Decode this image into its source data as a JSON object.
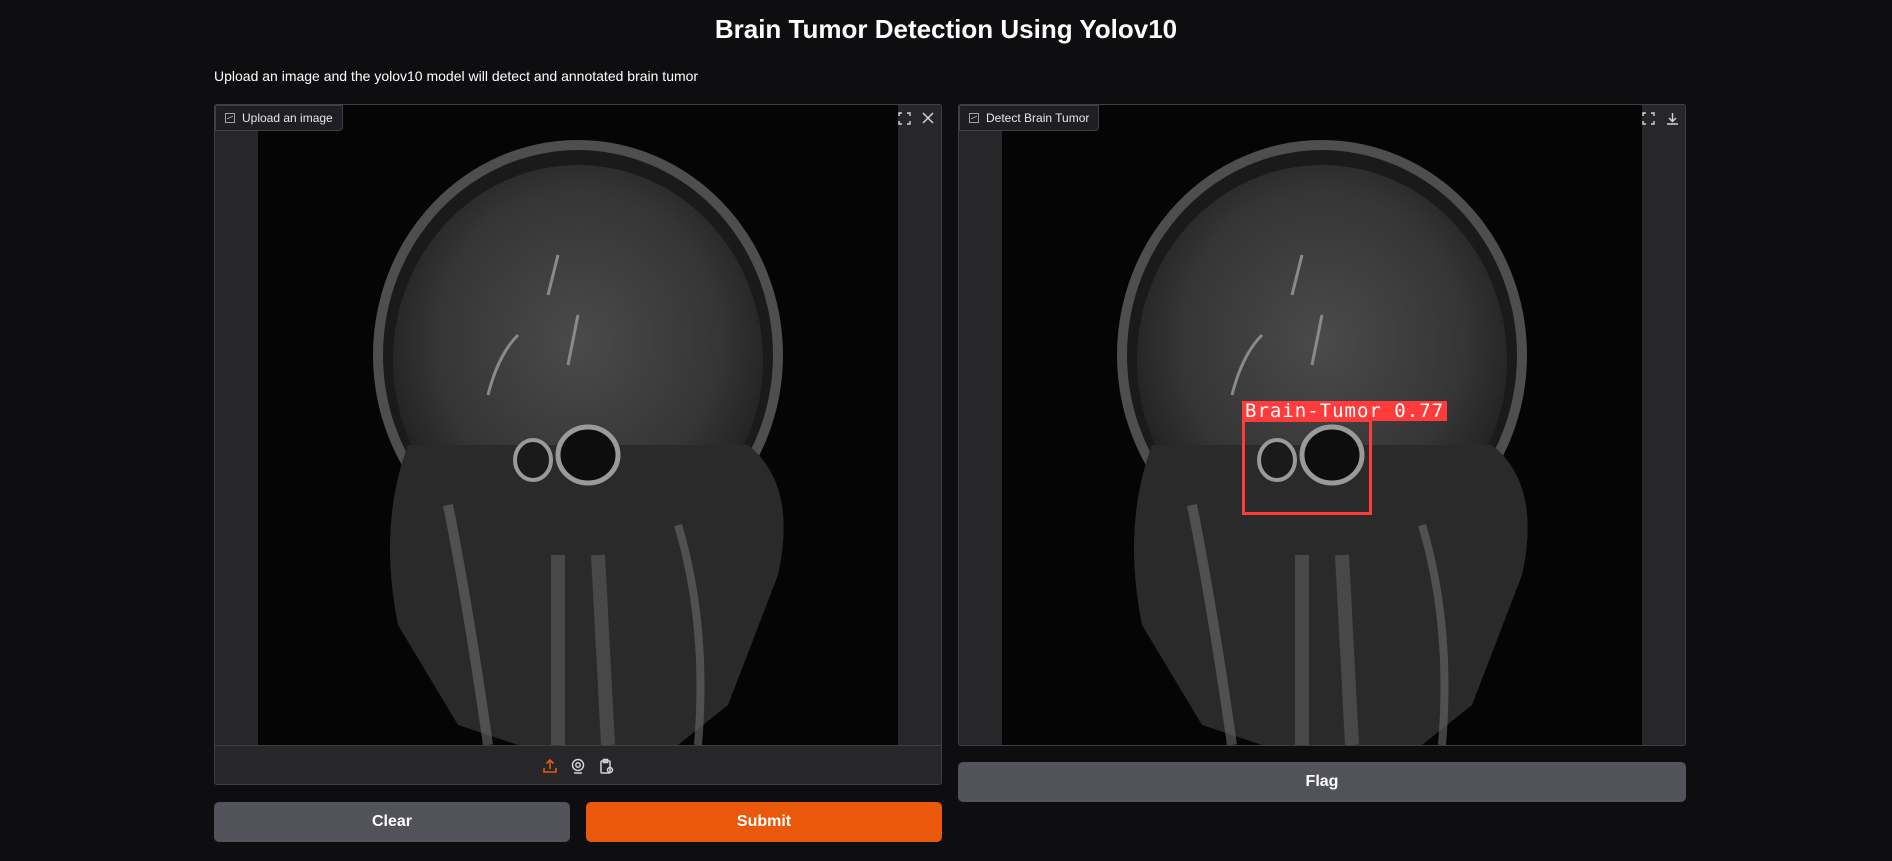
{
  "page": {
    "title": "Brain Tumor Detection Using Yolov10",
    "description": "Upload an image and the yolov10 model will detect and annotated brain tumor"
  },
  "input_panel": {
    "label": "Upload an image",
    "icons": [
      "image-icon",
      "fullscreen-icon",
      "close-icon"
    ],
    "toolbar_icons": [
      "upload-icon",
      "webcam-icon",
      "clipboard-icon"
    ],
    "accent_color": "#ea580c"
  },
  "output_panel": {
    "label": "Detect Brain Tumor",
    "icons": [
      "image-icon",
      "fullscreen-icon",
      "download-icon"
    ],
    "detection": {
      "label": "Brain-Tumor",
      "confidence": "0.77",
      "color": "#ff3b3b"
    }
  },
  "buttons": {
    "clear": "Clear",
    "submit": "Submit",
    "flag": "Flag"
  }
}
